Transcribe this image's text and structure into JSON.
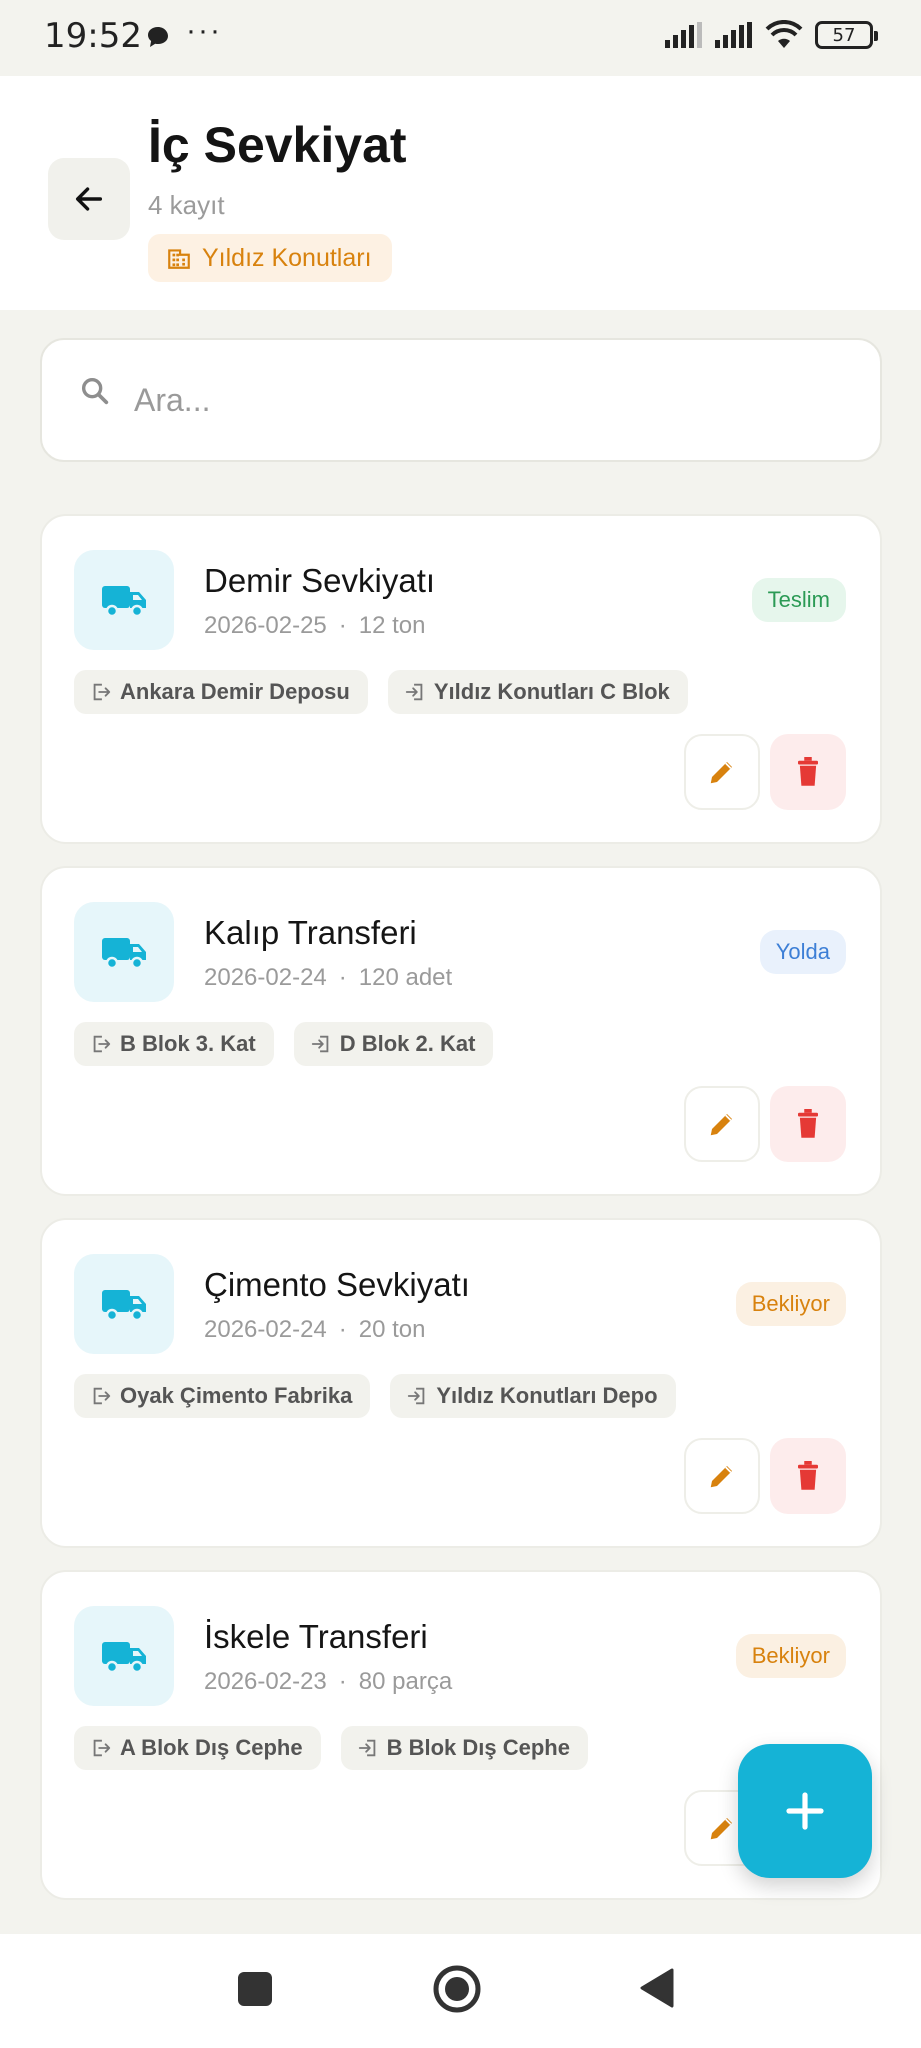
{
  "status_bar": {
    "time": "19:52",
    "battery": "57"
  },
  "header": {
    "title": "İç Sevkiyat",
    "record_count": "4 kayıt",
    "project": "Yıldız Konutları"
  },
  "search": {
    "placeholder": "Ara..."
  },
  "shipments": [
    {
      "title": "Demir Sevkiyatı",
      "date": "2026-02-25",
      "separator": "·",
      "quantity": "12 ton",
      "status": "Teslim",
      "from": "Ankara Demir Deposu",
      "to": "Yıldız Konutları C Blok"
    },
    {
      "title": "Kalıp Transferi",
      "date": "2026-02-24",
      "separator": "·",
      "quantity": "120 adet",
      "status": "Yolda",
      "from": "B Blok 3. Kat",
      "to": "D Blok 2. Kat"
    },
    {
      "title": "Çimento Sevkiyatı",
      "date": "2026-02-24",
      "separator": "·",
      "quantity": "20 ton",
      "status": "Bekliyor",
      "from": "Oyak Çimento Fabrika",
      "to": "Yıldız Konutları Depo"
    },
    {
      "title": "İskele Transferi",
      "date": "2026-02-23",
      "separator": "·",
      "quantity": "80 parça",
      "status": "Bekliyor",
      "from": "A Blok Dış Cephe",
      "to": "B Blok Dış Cephe"
    }
  ],
  "colors": {
    "accent": "#15b3d6",
    "status_delivered": "#2b9a55",
    "status_in_transit": "#3d7fd6",
    "status_pending": "#d8820e",
    "delete": "#e53935",
    "edit": "#d8820e"
  },
  "icons": {
    "back": "arrow-left-icon",
    "project": "building-icon",
    "search": "search-icon",
    "shipment": "truck-icon",
    "from": "exit-icon",
    "to": "enter-icon",
    "edit": "pencil-icon",
    "delete": "trash-icon",
    "add": "plus-icon"
  }
}
